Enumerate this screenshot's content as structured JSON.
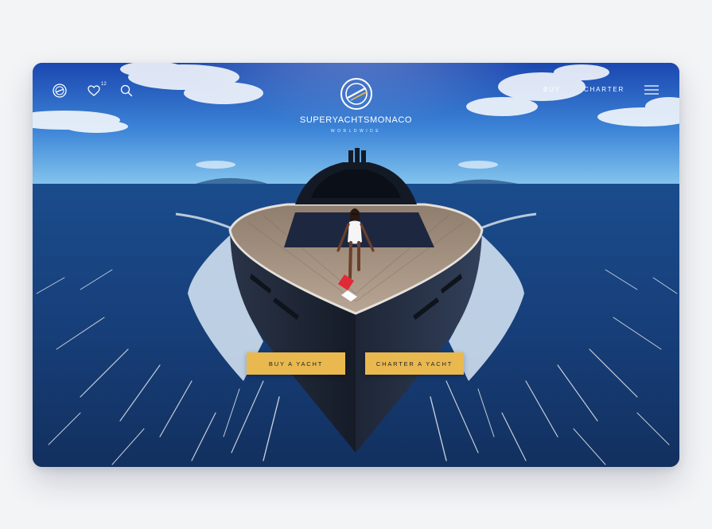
{
  "header": {
    "favorites_count": "12",
    "brand_name": "SUPERYACHTSMONACO",
    "brand_tagline": "WORLDWIDE",
    "nav": {
      "buy_label": "BUY",
      "charter_label": "CHARTER"
    },
    "icons": {
      "left_logo": "globe-logo-icon",
      "favorites": "heart-icon",
      "search": "search-icon",
      "brand_logo": "brand-emblem-icon",
      "menu": "hamburger-menu-icon"
    }
  },
  "hero": {
    "buy_button_label": "BUY A YACHT",
    "charter_button_label": "CHARTER A YACHT"
  },
  "colors": {
    "accent": "#e9b94f",
    "sky_top": "#1d4fb8",
    "sky_bottom": "#7cc0ec",
    "sea": "#163b73",
    "hull": "#1c2432",
    "deck": "#a89584"
  }
}
